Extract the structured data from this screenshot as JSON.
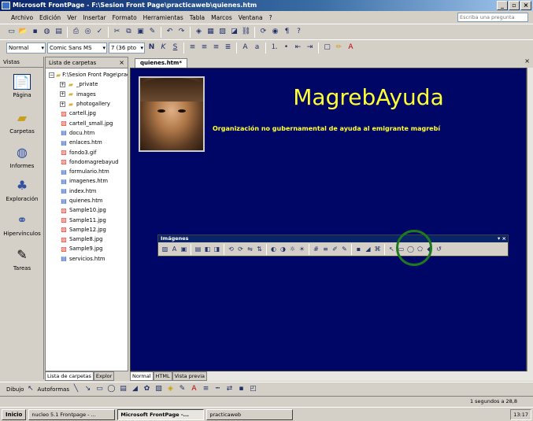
{
  "window": {
    "title": "Microsoft FrontPage - F:\\Sesion Front Page\\practicaweb\\quienes.htm"
  },
  "menu": {
    "items": [
      "Archivo",
      "Edición",
      "Ver",
      "Insertar",
      "Formato",
      "Herramientas",
      "Tabla",
      "Marcos",
      "Ventana",
      "?"
    ],
    "help_placeholder": "Escriba una pregunta"
  },
  "format_bar": {
    "style": "Normal",
    "font": "Comic Sans MS",
    "size": "7 (36 pto"
  },
  "views": {
    "header": "Vistas",
    "items": [
      {
        "label": "Página",
        "icon": "page-icon"
      },
      {
        "label": "Carpetas",
        "icon": "folders-icon"
      },
      {
        "label": "Informes",
        "icon": "reports-icon"
      },
      {
        "label": "Exploración",
        "icon": "navigation-icon"
      },
      {
        "label": "Hipervínculos",
        "icon": "hyperlinks-icon"
      },
      {
        "label": "Tareas",
        "icon": "tasks-icon"
      }
    ]
  },
  "folders": {
    "header": "Lista de carpetas",
    "root": "F:\\Sesion Front Page\\practicaweb",
    "items": [
      {
        "name": "_private",
        "type": "folder"
      },
      {
        "name": "images",
        "type": "folder"
      },
      {
        "name": "photogallery",
        "type": "folder"
      },
      {
        "name": "cartell.jpg",
        "type": "image"
      },
      {
        "name": "cartell_small.jpg",
        "type": "image"
      },
      {
        "name": "docu.htm",
        "type": "html"
      },
      {
        "name": "enlaces.htm",
        "type": "html"
      },
      {
        "name": "fondo3.gif",
        "type": "image"
      },
      {
        "name": "fondomagrebayud",
        "type": "image"
      },
      {
        "name": "formulario.htm",
        "type": "html"
      },
      {
        "name": "imagenes.htm",
        "type": "html"
      },
      {
        "name": "index.htm",
        "type": "html"
      },
      {
        "name": "quienes.htm",
        "type": "html"
      },
      {
        "name": "Sample10.jpg",
        "type": "image"
      },
      {
        "name": "Sample11.jpg",
        "type": "image"
      },
      {
        "name": "Sample12.jpg",
        "type": "image"
      },
      {
        "name": "Sample8.jpg",
        "type": "image"
      },
      {
        "name": "Sample9.jpg",
        "type": "image"
      },
      {
        "name": "servicios.htm",
        "type": "html"
      }
    ],
    "tabs": [
      "Lista de carpetas",
      "Explor"
    ]
  },
  "document": {
    "tab": "quienes.htm*",
    "title": "MagrebAyuda",
    "subtitle": "Organización no gubernamental de ayuda al emigrante magrebí",
    "bottom_tabs": [
      "Normal",
      "HTML",
      "Vista previa"
    ]
  },
  "image_toolbar": {
    "title": "Imágenes"
  },
  "draw_toolbar": {
    "dibujo": "Dibujo",
    "autoformas": "Autoformas"
  },
  "status": {
    "text": "1 segundos a 28,8"
  },
  "taskbar": {
    "start": "Inicio",
    "tasks": [
      "nucleo 5.1 Frontpage - ...",
      "Microsoft FrontPage -...",
      "practicaweb"
    ],
    "clock": "13:17"
  },
  "colors": {
    "page_background": "#000666",
    "title_text": "#ffff33",
    "highlight_ring": "#1e7a1e"
  }
}
